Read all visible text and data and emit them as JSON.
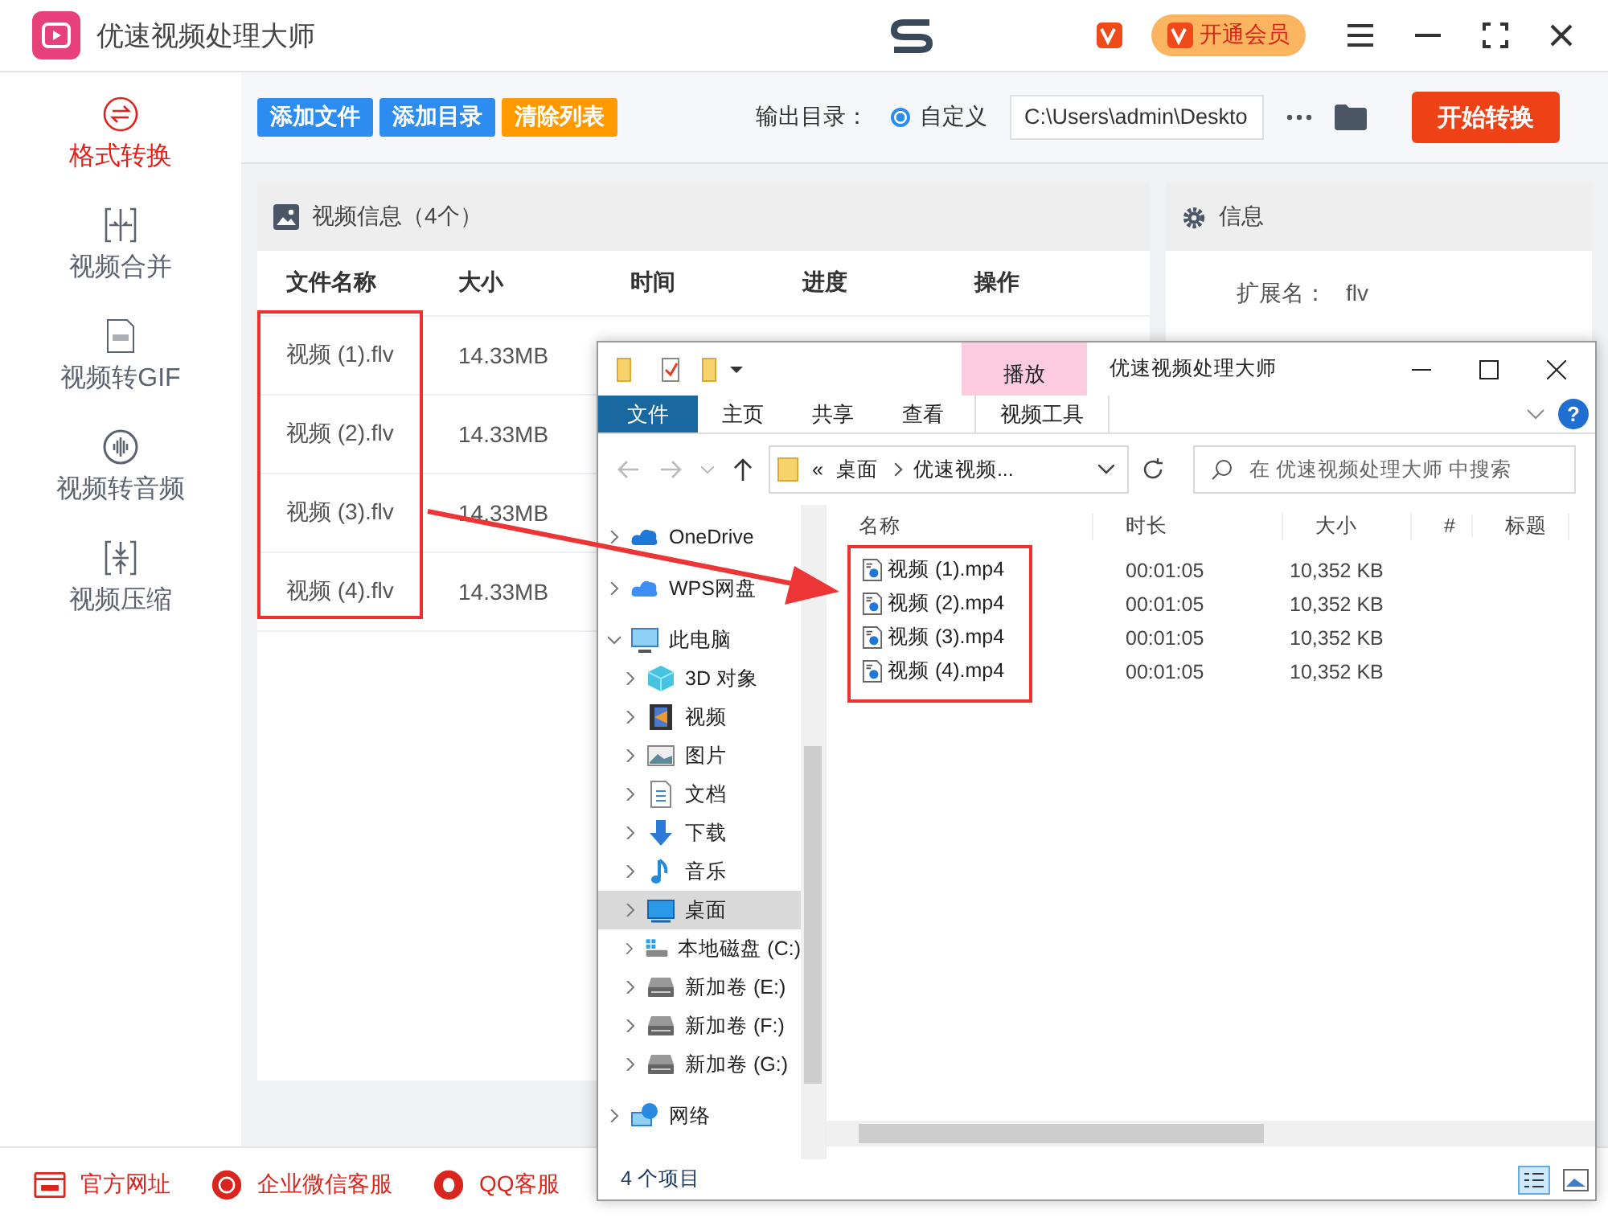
{
  "app": {
    "title": "优速视频处理大师",
    "vip_button": "开通会员"
  },
  "sidebar": [
    {
      "label": "格式转换",
      "kind": "convert",
      "selected": true
    },
    {
      "label": "视频合并",
      "kind": "merge",
      "selected": false
    },
    {
      "label": "视频转GIF",
      "kind": "gif",
      "selected": false
    },
    {
      "label": "视频转音频",
      "kind": "audio",
      "selected": false
    },
    {
      "label": "视频压缩",
      "kind": "compress",
      "selected": false
    }
  ],
  "toolbar": {
    "buttons": [
      {
        "label": "添加文件",
        "color": "#2d8cf0"
      },
      {
        "label": "添加目录",
        "color": "#2d8cf0"
      },
      {
        "label": "清除列表",
        "color": "#ff9900"
      }
    ],
    "output_label": "输出目录：",
    "output_option": "自定义",
    "output_option_selected": true,
    "output_path": "C:\\Users\\admin\\Deskto",
    "start_button": "开始转换"
  },
  "file_panel": {
    "title": "视频信息（4个）",
    "columns": [
      "文件名称",
      "大小",
      "时间",
      "进度",
      "操作"
    ],
    "rows": [
      {
        "name": "视频 (1).flv",
        "size": "14.33MB"
      },
      {
        "name": "视频 (2).flv",
        "size": "14.33MB"
      },
      {
        "name": "视频 (3).flv",
        "size": "14.33MB"
      },
      {
        "name": "视频 (4).flv",
        "size": "14.33MB"
      }
    ]
  },
  "info_panel": {
    "title": "信息",
    "fields": [
      {
        "label": "扩展名：",
        "value": "flv"
      }
    ]
  },
  "footer": [
    "官方网址",
    "企业微信客服",
    "QQ客服"
  ],
  "explorer": {
    "title": "优速视频处理大师",
    "context_label": "播放",
    "tabs": [
      {
        "label": "文件",
        "selected": true
      },
      {
        "label": "主页",
        "selected": false
      },
      {
        "label": "共享",
        "selected": false
      },
      {
        "label": "查看",
        "selected": false
      },
      {
        "label": "视频工具",
        "selected": false
      }
    ],
    "help": "?",
    "path": [
      "«",
      "桌面",
      "优速视频..."
    ],
    "search_placeholder": "在 优速视频处理大师 中搜索",
    "nav": [
      {
        "label": "OneDrive",
        "kind": "cloud",
        "expanded": false,
        "selected": false
      },
      {
        "label": "WPS网盘",
        "kind": "cloud2",
        "expanded": false,
        "selected": false
      },
      {
        "label": "此电脑",
        "kind": "pc",
        "expanded": true,
        "selected": false,
        "children": [
          {
            "label": "3D 对象",
            "kind": "cube",
            "expanded": false,
            "selected": false
          },
          {
            "label": "视频",
            "kind": "film",
            "expanded": false,
            "selected": false
          },
          {
            "label": "图片",
            "kind": "image",
            "expanded": false,
            "selected": false
          },
          {
            "label": "文档",
            "kind": "doc",
            "expanded": false,
            "selected": false
          },
          {
            "label": "下载",
            "kind": "download",
            "expanded": false,
            "selected": false
          },
          {
            "label": "音乐",
            "kind": "music",
            "expanded": false,
            "selected": false
          },
          {
            "label": "桌面",
            "kind": "desktop",
            "expanded": false,
            "selected": true
          },
          {
            "label": "本地磁盘 (C:)",
            "kind": "sysdrive",
            "expanded": false,
            "selected": false
          },
          {
            "label": "新加卷 (E:)",
            "kind": "drive",
            "expanded": false,
            "selected": false
          },
          {
            "label": "新加卷 (F:)",
            "kind": "drive",
            "expanded": false,
            "selected": false
          },
          {
            "label": "新加卷 (G:)",
            "kind": "drive",
            "expanded": false,
            "selected": false
          }
        ]
      },
      {
        "label": "网络",
        "kind": "network",
        "expanded": false,
        "selected": false
      }
    ],
    "columns": [
      "名称",
      "时长",
      "大小",
      "#",
      "标题"
    ],
    "files": [
      {
        "name": "视频 (1).mp4",
        "duration": "00:01:05",
        "size": "10,352 KB"
      },
      {
        "name": "视频 (2).mp4",
        "duration": "00:01:05",
        "size": "10,352 KB"
      },
      {
        "name": "视频 (3).mp4",
        "duration": "00:01:05",
        "size": "10,352 KB"
      },
      {
        "name": "视频 (4).mp4",
        "duration": "00:01:05",
        "size": "10,352 KB"
      }
    ],
    "status": "4 个项目"
  }
}
